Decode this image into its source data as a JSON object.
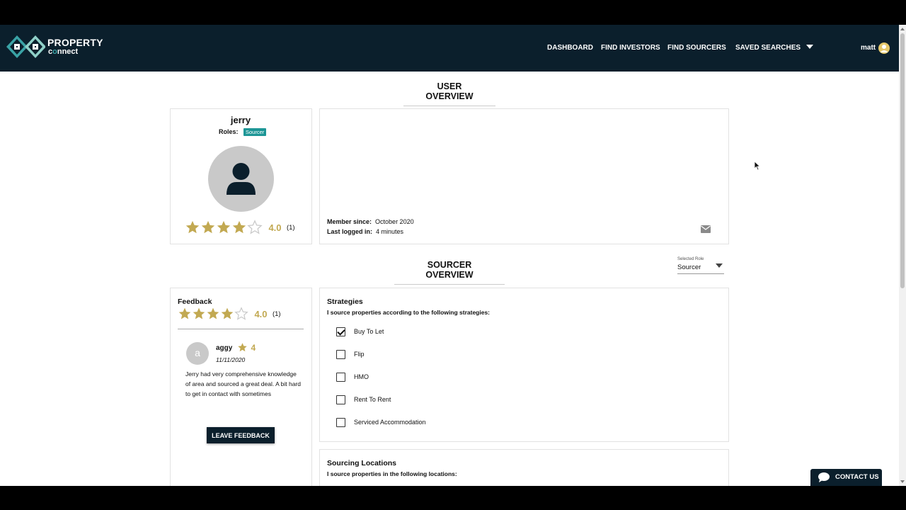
{
  "brand": {
    "line1": "PROPERTY",
    "line2_prefix": "c",
    "line2_accent": "o",
    "line2_suffix": "nnect"
  },
  "nav": {
    "links": [
      "DASHBOARD",
      "FIND INVESTORS",
      "FIND SOURCERS",
      "SAVED SEARCHES"
    ],
    "user": "matt"
  },
  "user_overview": {
    "title": "USER OVERVIEW",
    "name": "jerry",
    "roles_label": "Roles:",
    "role": "Sourcer",
    "rating": {
      "value": "4.0",
      "count": "(1)",
      "stars": 4,
      "max": 5
    },
    "member_since_label": "Member since:",
    "member_since": "October 2020",
    "last_logged_label": "Last logged in:",
    "last_logged": "4 minutes"
  },
  "sourcer_overview": {
    "title": "SOURCER OVERVIEW",
    "selected_role_label": "Selected Role",
    "selected_role": "Sourcer"
  },
  "feedback": {
    "heading": "Feedback",
    "rating": {
      "value": "4.0",
      "count": "(1)",
      "stars": 4,
      "max": 5
    },
    "review": {
      "initial": "a",
      "author": "aggy",
      "rating": "4",
      "date": "11/11/2020",
      "text": "Jerry had very comprehensive knowledge of area and sourced a great deal. A bit hard to get in contact with sometimes"
    },
    "button": "LEAVE FEEDBACK"
  },
  "strategies": {
    "heading": "Strategies",
    "subheading": "I source properties according to the following strategies:",
    "items": [
      {
        "label": "Buy To Let",
        "checked": true
      },
      {
        "label": "Flip",
        "checked": false
      },
      {
        "label": "HMO",
        "checked": false
      },
      {
        "label": "Rent To Rent",
        "checked": false
      },
      {
        "label": "Serviced Accommodation",
        "checked": false
      }
    ]
  },
  "locations": {
    "heading": "Sourcing Locations",
    "subheading": "I source properties in the following locations:"
  },
  "contact": {
    "label": "CONTACT US"
  },
  "colors": {
    "navy": "#0b1f2c",
    "teal": "#1d9696",
    "gold": "#c2a952"
  }
}
